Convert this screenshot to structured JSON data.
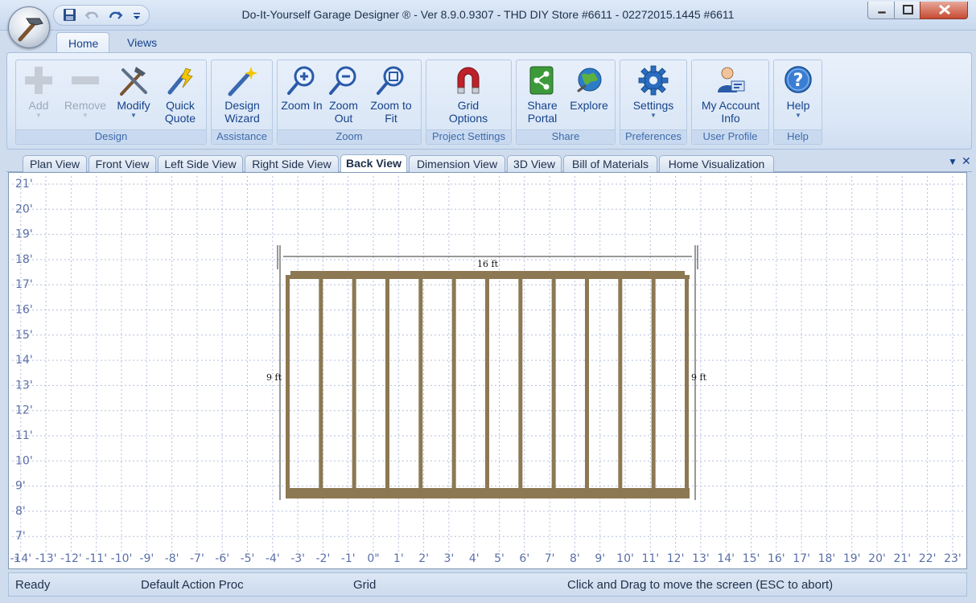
{
  "window": {
    "title": "Do-It-Yourself Garage Designer ® - Ver 8.9.0.9307 - THD DIY Store #6611 - 02272015.1445 #6611",
    "app_icon": "hammer-icon"
  },
  "quick_access": {
    "items": [
      {
        "icon": "save-icon"
      },
      {
        "icon": "undo-icon"
      },
      {
        "icon": "redo-icon"
      },
      {
        "icon": "customize-dropdown-icon"
      }
    ]
  },
  "ribbon": {
    "tabs": [
      {
        "label": "Home",
        "active": true
      },
      {
        "label": "Views",
        "active": false
      }
    ],
    "groups": [
      {
        "label": "Design",
        "buttons": [
          {
            "label": "Add",
            "icon": "plus-icon",
            "enabled": false,
            "dropdown": true
          },
          {
            "label": "Remove",
            "icon": "minus-icon",
            "enabled": false,
            "dropdown": true
          },
          {
            "label": "Modify",
            "icon": "tools-icon",
            "enabled": true,
            "dropdown": true
          },
          {
            "label": "Quick Quote",
            "icon": "quote-wand-icon",
            "enabled": true,
            "dropdown": false
          }
        ]
      },
      {
        "label": "Assistance",
        "buttons": [
          {
            "label": "Design Wizard",
            "icon": "magic-wand-icon",
            "enabled": true
          }
        ]
      },
      {
        "label": "Zoom",
        "buttons": [
          {
            "label": "Zoom In",
            "icon": "zoom-in-icon",
            "enabled": true
          },
          {
            "label": "Zoom Out",
            "icon": "zoom-out-icon",
            "enabled": true
          },
          {
            "label": "Zoom to Fit",
            "icon": "zoom-fit-icon",
            "enabled": true
          }
        ]
      },
      {
        "label": "Project Settings",
        "buttons": [
          {
            "label": "Grid Options",
            "icon": "magnet-icon",
            "enabled": true
          }
        ]
      },
      {
        "label": "Share",
        "buttons": [
          {
            "label": "Share Portal",
            "icon": "share-portal-icon",
            "enabled": true
          },
          {
            "label": "Explore",
            "icon": "globe-icon",
            "enabled": true
          }
        ]
      },
      {
        "label": "Preferences",
        "buttons": [
          {
            "label": "Settings",
            "icon": "gear-icon",
            "enabled": true,
            "dropdown": true
          }
        ]
      },
      {
        "label": "User Profile",
        "buttons": [
          {
            "label": "My Account Info",
            "icon": "user-account-icon",
            "enabled": true
          }
        ]
      },
      {
        "label": "Help",
        "buttons": [
          {
            "label": "Help",
            "icon": "help-icon",
            "enabled": true,
            "dropdown": true
          }
        ]
      }
    ]
  },
  "doc_tabs": [
    {
      "label": "Plan View",
      "active": false
    },
    {
      "label": "Front View",
      "active": false
    },
    {
      "label": "Left Side View",
      "active": false
    },
    {
      "label": "Right Side View",
      "active": false
    },
    {
      "label": "Back View",
      "active": true
    },
    {
      "label": "Dimension View",
      "active": false
    },
    {
      "label": "3D View",
      "active": false
    },
    {
      "label": "Bill of Materials",
      "active": false
    },
    {
      "label": "Home Visualization",
      "active": false
    }
  ],
  "canvas": {
    "y_ticks": [
      "21'",
      "20'",
      "19'",
      "18'",
      "17'",
      "16'",
      "15'",
      "14'",
      "13'",
      "12'",
      "11'",
      "10'",
      "9'",
      "8'",
      "7'"
    ],
    "x_ticks": [
      "-14'",
      "-13'",
      "-12'",
      "-11'",
      "-10'",
      "-9'",
      "-8'",
      "-7'",
      "-6'",
      "-5'",
      "-4'",
      "-3'",
      "-2'",
      "-1'",
      "0\"",
      "1'",
      "2'",
      "3'",
      "4'",
      "5'",
      "6'",
      "7'",
      "8'",
      "9'",
      "10'",
      "11'",
      "12'",
      "13'",
      "14'",
      "15'",
      "16'",
      "17'",
      "18'",
      "19'",
      "20'",
      "21'",
      "22'",
      "23'"
    ],
    "wall": {
      "width_label": "16 ft",
      "height_label_left": "9 ft",
      "height_label_right": "9 ft",
      "stud_count": 13,
      "frame_color": "#8c7852",
      "grid_color": "#b4bfdc",
      "tick_color": "#5a6fa8"
    },
    "corner_marker": "3"
  },
  "status": {
    "ready": "Ready",
    "action": "Default Action Proc",
    "grid": "Grid",
    "hint": "Click and Drag to move the screen  (ESC to abort)"
  }
}
